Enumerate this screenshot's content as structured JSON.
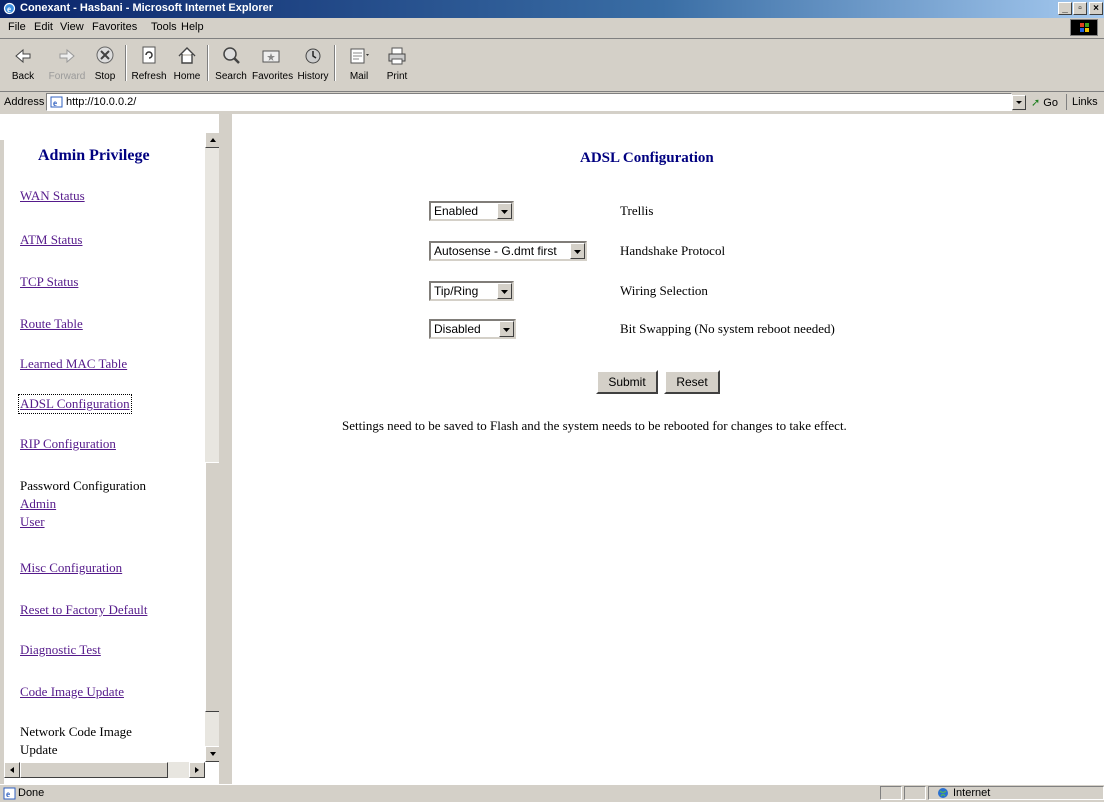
{
  "window": {
    "title": "Conexant - Hasbani - Microsoft Internet Explorer"
  },
  "menu": [
    "File",
    "Edit",
    "View",
    "Favorites",
    "Tools",
    "Help"
  ],
  "toolbar": {
    "back": "Back",
    "forward": "Forward",
    "stop": "Stop",
    "refresh": "Refresh",
    "home": "Home",
    "search": "Search",
    "favorites": "Favorites",
    "history": "History",
    "mail": "Mail",
    "print": "Print"
  },
  "address": {
    "label": "Address",
    "url": "http://10.0.0.2/",
    "go": "Go",
    "links": "Links"
  },
  "sidebar": {
    "heading": "Admin Privilege",
    "items": [
      "WAN Status",
      "ATM Status",
      "TCP Status",
      "Route Table",
      "Learned MAC Table",
      "ADSL Configuration",
      "RIP Configuration"
    ],
    "password": {
      "label": "Password Configuration",
      "admin": "Admin",
      "user": "User"
    },
    "items2": [
      "Misc Configuration",
      "Reset to Factory Default",
      "Diagnostic Test",
      "Code Image Update"
    ],
    "network_code": [
      "Network Code Image",
      "Update"
    ]
  },
  "main": {
    "title": "ADSL Configuration",
    "fields": [
      {
        "value": "Enabled",
        "label": "Trellis"
      },
      {
        "value": "Autosense - G.dmt first",
        "label": "Handshake Protocol"
      },
      {
        "value": "Tip/Ring",
        "label": "Wiring Selection"
      },
      {
        "value": "Disabled",
        "label": "Bit Swapping (No system reboot needed)"
      }
    ],
    "submit": "Submit",
    "reset": "Reset",
    "note": "Settings need to be saved to Flash and the system needs to be rebooted for changes to take effect."
  },
  "status": {
    "text": "Done",
    "zone": "Internet"
  },
  "colors": {
    "titlebar": "#0a246a",
    "link": "#551a8b",
    "heading": "#000080"
  }
}
